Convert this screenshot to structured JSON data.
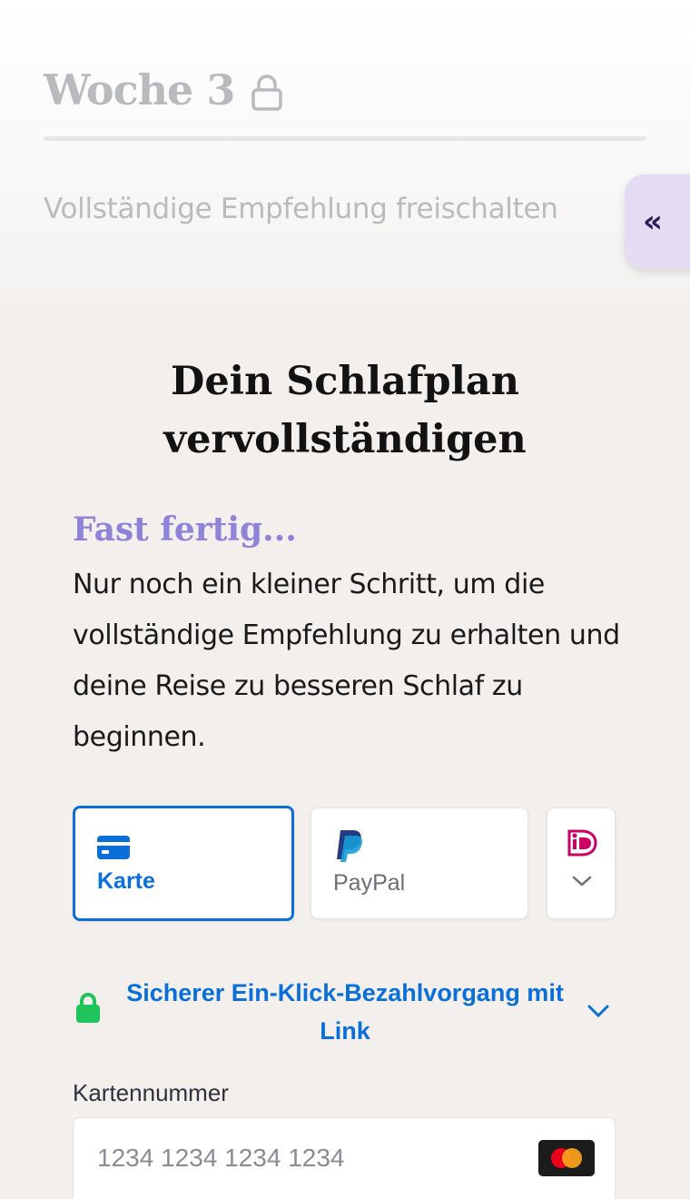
{
  "header": {
    "week_title": "Woche 3",
    "unlock_text": "Vollständige Empfehlung freischalten",
    "collapse_label": "«"
  },
  "main": {
    "title_line1": "Dein Schlafplan",
    "title_line2": "vervollständigen",
    "subtitle": "Fast fertig...",
    "description": "Nur noch ein kleiner Schritt, um die vollständige Empfehlung zu erhalten und deine Reise zu besseren Schlaf zu beginnen."
  },
  "payment": {
    "tabs": [
      {
        "label": "Karte",
        "icon": "credit-card-icon",
        "selected": true
      },
      {
        "label": "PayPal",
        "icon": "paypal-icon",
        "selected": false
      },
      {
        "label": "",
        "icon": "ideal-icon",
        "selected": false
      }
    ],
    "link_text": "Sicherer Ein-Klick-Bezahlvorgang mit Link",
    "card_number_label": "Kartennummer",
    "card_number_placeholder": "1234 1234 1234 1234",
    "card_brand_icon": "mastercard-icon"
  },
  "colors": {
    "accent_blue": "#0a6fd8",
    "subtitle_purple": "#8f82d9",
    "collapse_bg": "#e4dcf3",
    "secure_green": "#1fc45a"
  }
}
